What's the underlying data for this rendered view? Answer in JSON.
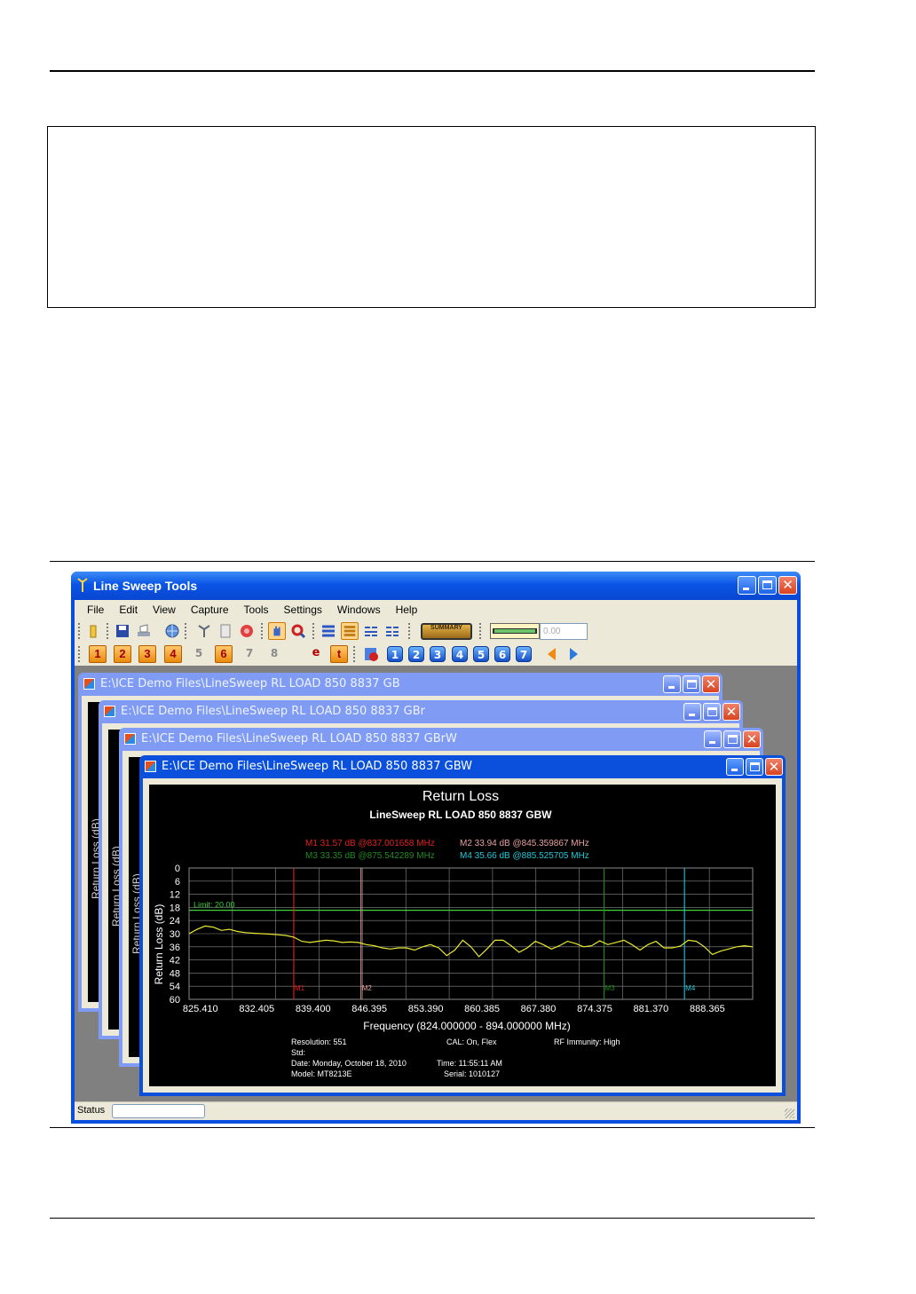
{
  "app": {
    "title": "Line Sweep Tools",
    "menu": [
      "File",
      "Edit",
      "View",
      "Capture",
      "Tools",
      "Settings",
      "Windows",
      "Help"
    ],
    "toolbar": {
      "summary_label": "SUMMARY",
      "zoom_value": "0.00",
      "trace_buttons": [
        "1",
        "2",
        "3",
        "4",
        "5",
        "6",
        "7",
        "8"
      ],
      "marker_letters": [
        "e",
        "t"
      ],
      "page_buttons": [
        "1",
        "2",
        "3",
        "4",
        "5",
        "6",
        "7"
      ]
    },
    "status_label": "Status"
  },
  "windows": [
    {
      "title": "E:\\ICE Demo Files\\LineSweep RL LOAD 850 8837 GB",
      "ylabel": "Return Loss (dB)"
    },
    {
      "title": "E:\\ICE Demo Files\\LineSweep RL LOAD 850 8837 GBr",
      "ylabel": "Return Loss (dB)"
    },
    {
      "title": "E:\\ICE Demo Files\\LineSweep RL LOAD 850 8837 GBrW",
      "ylabel": "Return Loss (dB)"
    },
    {
      "title": "E:\\ICE Demo Files\\LineSweep RL LOAD 850 8837 GBW"
    }
  ],
  "colors": {
    "trace": "#e8e830",
    "limit": "#40d040",
    "grid": "#8a8a8a",
    "m1": "#e02020",
    "m2": "#e8a0a0",
    "m3": "#208a20",
    "m4": "#20c8d8"
  },
  "chart_data": {
    "type": "line",
    "title": "Return Loss",
    "subtitle": "LineSweep RL LOAD 850 8837 GBW",
    "ylabel": "Return Loss (dB)",
    "xlabel": "Frequency (824.000000 - 894.000000 MHz)",
    "x_ticks": [
      "825.410",
      "832.405",
      "839.400",
      "846.395",
      "853.390",
      "860.385",
      "867.380",
      "874.375",
      "881.370",
      "888.365"
    ],
    "y_ticks": [
      "0",
      "6",
      "12",
      "18",
      "24",
      "30",
      "36",
      "42",
      "48",
      "54",
      "60"
    ],
    "xlim": [
      824.0,
      894.0
    ],
    "ylim": [
      0,
      60
    ],
    "y_inverted": true,
    "grid": true,
    "limit": {
      "label": "Limit: 20.00",
      "value": 19.3
    },
    "markers": [
      {
        "name": "M1",
        "label": "M1 31.57 dB @837.001658 MHz",
        "x": 837.0,
        "color": "#e02020"
      },
      {
        "name": "M2",
        "label": "M2 33.94 dB @845.359867 MHz",
        "x": 845.36,
        "color": "#e8a0a0"
      },
      {
        "name": "M3",
        "label": "M3 33.35 dB @875.542289 MHz",
        "x": 875.54,
        "color": "#208a20"
      },
      {
        "name": "M4",
        "label": "M4 35.66 dB @885.525705 MHz",
        "x": 885.53,
        "color": "#20c8d8"
      }
    ],
    "series": [
      {
        "x": [
          824.0,
          825.0,
          826.0,
          827.0,
          828.0,
          829.0,
          830.0,
          831.0,
          832.0,
          833.0,
          834.0,
          835.0,
          836.0,
          837.0,
          838.0,
          839.0,
          840.0,
          841.0,
          842.0,
          843.0,
          844.0,
          845.0,
          846.0,
          847.0,
          848.0,
          849.0,
          850.0,
          851.0,
          852.0,
          853.0,
          854.0,
          855.0,
          856.0,
          857.0,
          858.0,
          859.0,
          860.0,
          861.0,
          862.0,
          863.0,
          864.0,
          865.0,
          866.0,
          867.0,
          868.0,
          869.0,
          870.0,
          871.0,
          872.0,
          873.0,
          874.0,
          875.0,
          876.0,
          877.0,
          878.0,
          879.0,
          880.0,
          881.0,
          882.0,
          883.0,
          884.0,
          885.0,
          886.0,
          887.0,
          888.0,
          889.0,
          890.0,
          891.0,
          892.0,
          893.0,
          894.0
        ],
        "y": [
          30,
          28,
          26.5,
          27,
          28.5,
          28,
          29,
          29.5,
          29.8,
          30,
          30.2,
          30.5,
          30.8,
          31.6,
          33.5,
          34,
          33.5,
          33,
          33.3,
          34,
          33.8,
          34,
          35,
          35.5,
          36.5,
          37,
          36.5,
          36.5,
          37.5,
          36,
          35,
          36.5,
          40,
          37.5,
          33,
          36,
          40.5,
          37,
          33,
          33,
          35.5,
          38.5,
          36.5,
          33.5,
          35,
          37,
          35.5,
          33.5,
          34.5,
          36,
          35.5,
          33.3,
          35,
          34,
          33,
          35,
          37.5,
          35,
          33.5,
          36.5,
          36.5,
          35.7,
          33,
          33.5,
          36,
          39.5,
          38,
          37,
          36,
          35.5,
          36
        ]
      }
    ],
    "info": {
      "resolution": "Resolution: 551",
      "std": "Std:",
      "date": "Date: Monday, October 18, 2010",
      "model": "Model: MT8213E",
      "cal": "CAL: On, Flex",
      "time": "Time: 11:55:11 AM",
      "serial": "Serial: 1010127",
      "rf_immunity": "RF Immunity: High"
    }
  }
}
